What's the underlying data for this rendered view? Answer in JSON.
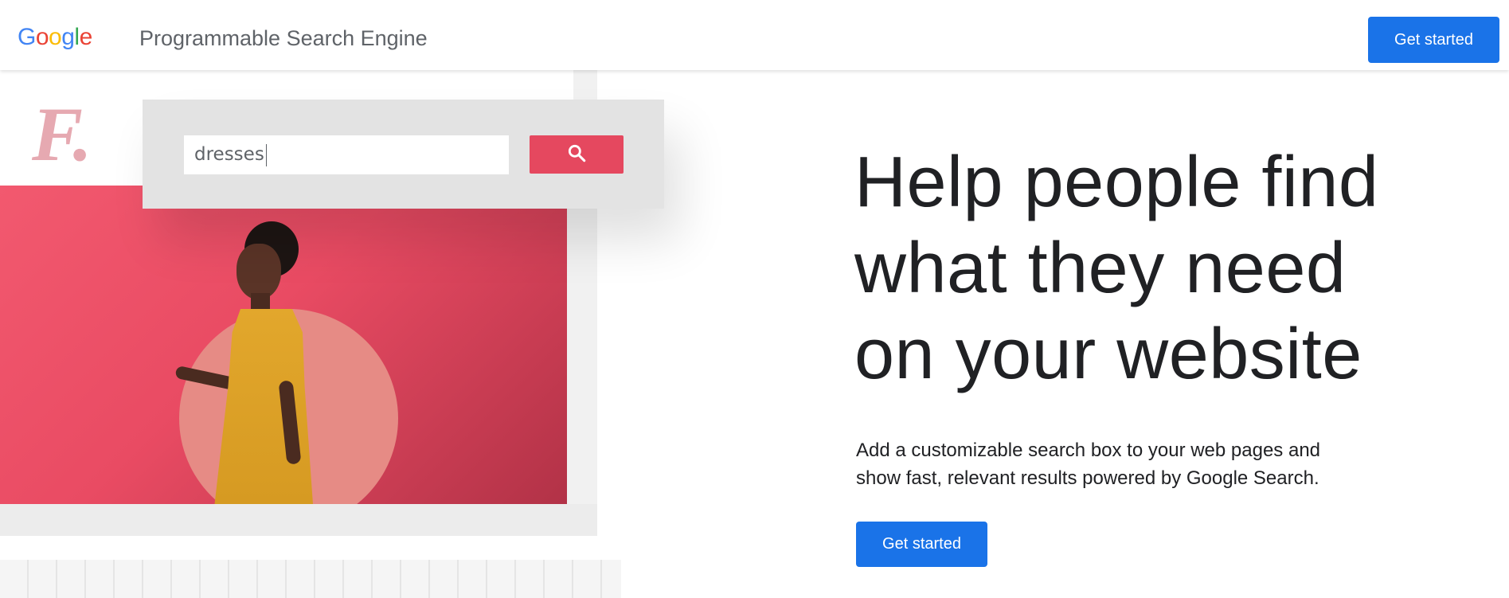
{
  "header": {
    "logo_letters": [
      {
        "char": "G",
        "color": "#4285f4"
      },
      {
        "char": "o",
        "color": "#ea4335"
      },
      {
        "char": "o",
        "color": "#fbbc05"
      },
      {
        "char": "g",
        "color": "#4285f4"
      },
      {
        "char": "l",
        "color": "#34a853"
      },
      {
        "char": "e",
        "color": "#ea4335"
      }
    ],
    "product_name": "Programmable Search Engine",
    "cta_label": "Get started"
  },
  "illustration": {
    "brand_mark": "F.",
    "search_value": "dresses",
    "search_button_icon": "search-icon"
  },
  "hero": {
    "title_lines": [
      "Help people find",
      "what they need",
      "on your website"
    ],
    "subtitle_lines": [
      "Add a customizable search box to your web pages and",
      "show fast, relevant results powered by Google Search."
    ],
    "cta_label": "Get started"
  },
  "colors": {
    "primary_blue": "#1a73e8",
    "accent_pink": "#e5485f",
    "text_dark": "#202124",
    "text_gray": "#5f6368"
  }
}
